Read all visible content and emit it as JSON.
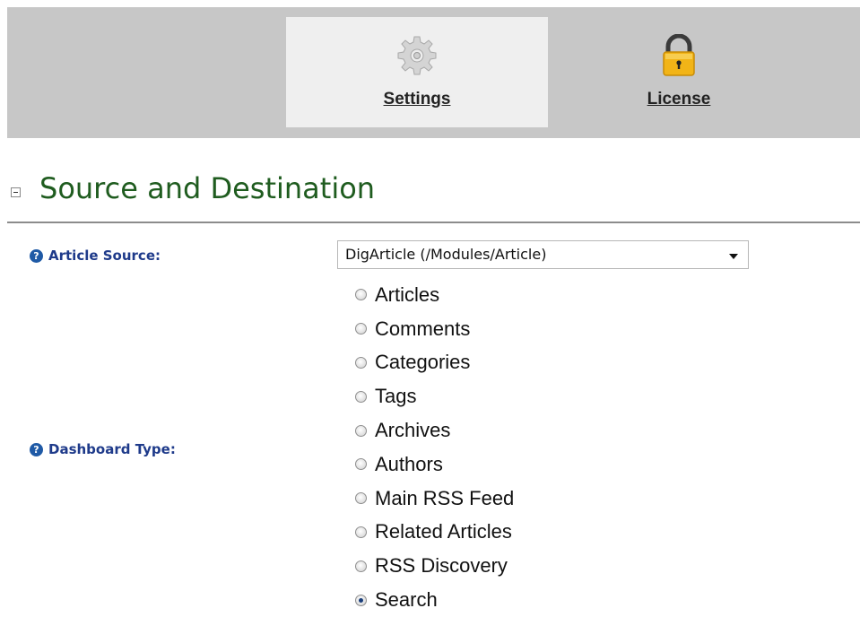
{
  "nav": {
    "tabs": [
      {
        "label": "Settings",
        "icon": "gear-icon",
        "active": true
      },
      {
        "label": "License",
        "icon": "lock-icon",
        "active": false
      }
    ]
  },
  "section": {
    "title": "Source and Destination",
    "collapse_icon": "collapse-icon"
  },
  "fields": {
    "article_source": {
      "label": "Article Source:",
      "selected": "DigArticle (/Modules/Article)"
    },
    "dashboard_type": {
      "label": "Dashboard Type:",
      "options": [
        "Articles",
        "Comments",
        "Categories",
        "Tags",
        "Archives",
        "Authors",
        "Main RSS Feed",
        "Related Articles",
        "RSS Discovery",
        "Search"
      ],
      "selected": "Search"
    }
  },
  "colors": {
    "topbar_bg": "#c7c7c7",
    "active_tab_bg": "#efefef",
    "section_title": "#1f5c1f",
    "field_label": "#1e3a8a",
    "help_icon": "#1f5aa6"
  }
}
